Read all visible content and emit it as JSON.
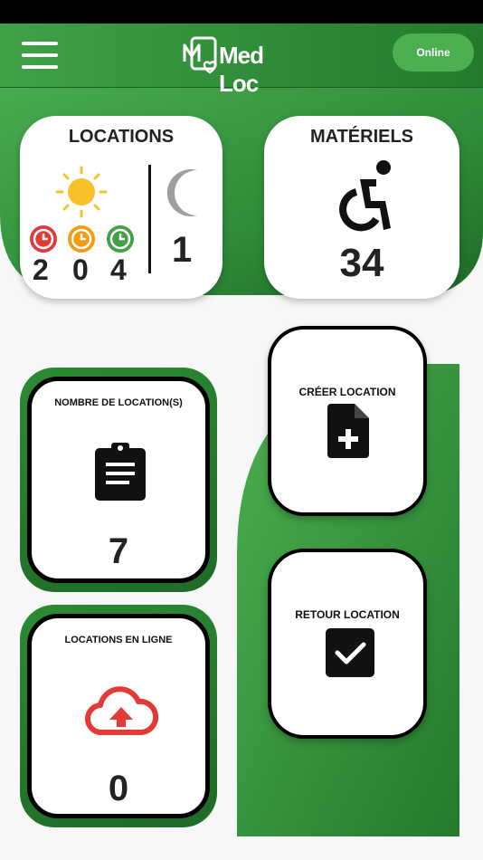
{
  "header": {
    "logo_text": "Med Loc",
    "online_label": "Online"
  },
  "locations_card": {
    "title": "LOCATIONS",
    "day_counts": [
      "2",
      "0",
      "4"
    ],
    "night_count": "1"
  },
  "materiels_card": {
    "title": "MATÉRIELS",
    "count": "34"
  },
  "nombre_card": {
    "label": "NOMBRE DE LOCATION(S)",
    "count": "7"
  },
  "en_ligne_card": {
    "label": "LOCATIONS EN LIGNE",
    "count": "0"
  },
  "creer_button": {
    "label": "CRÉER LOCATION"
  },
  "retour_button": {
    "label": "RETOUR LOCATION"
  },
  "colors": {
    "primary_green": "#3fa247",
    "dark_green": "#237a2c",
    "sun": "#f9c02a",
    "moon": "#9e9e9e",
    "clock_red": "#e53935",
    "clock_orange": "#f39c12",
    "clock_green": "#43a047",
    "cloud_red": "#e53935"
  }
}
